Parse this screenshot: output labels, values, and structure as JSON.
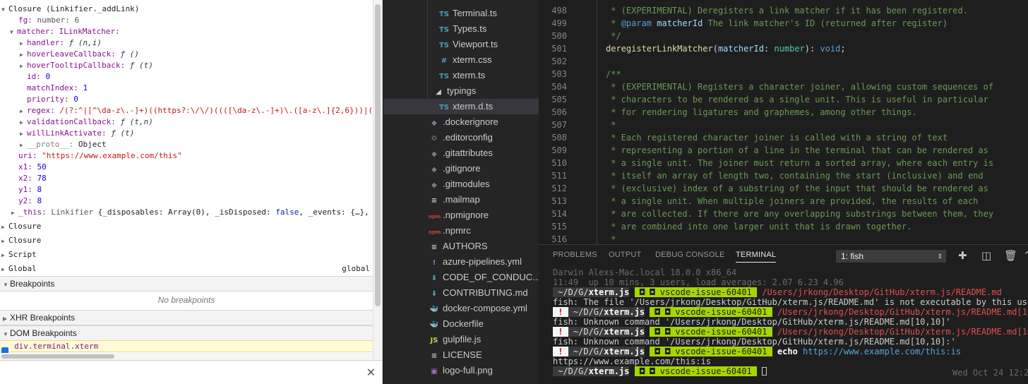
{
  "devtools": {
    "scope": {
      "closure_header": "Closure (Linkifier._addLink)",
      "fg_key": "fg:",
      "fg_value": "number: 6",
      "matcher_key": "matcher:",
      "matcher_type": "ILinkMatcher:",
      "handler_key": "handler:",
      "handler_val": "ƒ (n,i)",
      "hoverLeave_key": "hoverLeaveCallback:",
      "hoverLeave_val": "ƒ ()",
      "hoverTooltip_key": "hoverTooltipCallback:",
      "hoverTooltip_val": "ƒ (t)",
      "id_key": "id:",
      "id_val": "0",
      "matchIndex_key": "matchIndex:",
      "matchIndex_val": "1",
      "priority_key": "priority:",
      "priority_val": "0",
      "regex_key": "regex:",
      "regex_val": "/(?:^|[^\\da-z\\.-]+)((https?:\\/\\/)((([\\da-z\\.-]+)\\.([a-z\\.]{2,6}))|(",
      "validation_key": "validationCallback:",
      "validation_val": "ƒ (t,n)",
      "willLink_key": "willLinkActivate:",
      "willLink_val": "ƒ (t)",
      "proto_key": "__proto__:",
      "proto_val": "Object",
      "uri_key": "uri:",
      "uri_val": "\"https://www.example.com/this\"",
      "x1_key": "x1:",
      "x1_val": "50",
      "x2_key": "x2:",
      "x2_val": "78",
      "y1_key": "y1:",
      "y1_val": "8",
      "y2_key": "y2:",
      "y2_val": "8",
      "this_key": "_this:",
      "this_class": "Linkifier",
      "this_val_a": "{_disposables: Array(0), _isDisposed:",
      "this_val_b": "false",
      "this_val_c": ", _events: {…},",
      "closure2": "Closure",
      "closure3": "Closure",
      "script": "Script",
      "global": "Global",
      "global_right": "global"
    },
    "breakpoints": {
      "title": "Breakpoints",
      "empty": "No breakpoints"
    },
    "xhr": {
      "title": "XHR Breakpoints"
    },
    "dom": {
      "title": "DOM Breakpoints",
      "item": "div.terminal.xterm"
    },
    "close_glyph": "✕"
  },
  "explorer": {
    "files": [
      {
        "icon": "TS",
        "name": "Terminal.ts"
      },
      {
        "icon": "TS",
        "name": "Types.ts"
      },
      {
        "icon": "TS",
        "name": "Viewport.ts"
      },
      {
        "icon": "#",
        "name": "xterm.css"
      },
      {
        "icon": "TS",
        "name": "xterm.ts"
      },
      {
        "icon": "◢",
        "name": "typings"
      },
      {
        "icon": "TS",
        "name": "xterm.d.ts"
      },
      {
        "icon": "◆",
        "name": ".dockerignore"
      },
      {
        "icon": "⚙",
        "name": ".editorconfig"
      },
      {
        "icon": "◆",
        "name": ".gitattributes"
      },
      {
        "icon": "◆",
        "name": ".gitignore"
      },
      {
        "icon": "◆",
        "name": ".gitmodules"
      },
      {
        "icon": "≡",
        "name": ".mailmap"
      },
      {
        "icon": "npm",
        "name": ".npmignore"
      },
      {
        "icon": "npm",
        "name": ".npmrc"
      },
      {
        "icon": "≡",
        "name": "AUTHORS"
      },
      {
        "icon": "!",
        "name": "azure-pipelines.yml"
      },
      {
        "icon": "⬇",
        "name": "CODE_OF_CONDUC..."
      },
      {
        "icon": "⬇",
        "name": "CONTRIBUTING.md"
      },
      {
        "icon": "🐳",
        "name": "docker-compose.yml"
      },
      {
        "icon": "🐳",
        "name": "Dockerfile"
      },
      {
        "icon": "JS",
        "name": "gulpfile.js"
      },
      {
        "icon": "≡",
        "name": "LICENSE"
      },
      {
        "icon": "▣",
        "name": "logo-full.png"
      }
    ]
  },
  "editor": {
    "lines": [
      {
        "n": "498",
        "text": " * (EXPERIMENTAL) Deregisters a link matcher if it has been registered."
      },
      {
        "n": "499",
        "text": " * @param matcherId The link matcher's ID (returned after register)"
      },
      {
        "n": "500",
        "text": " */"
      },
      {
        "n": "501",
        "text": "deregisterLinkMatcher(matcherId: number): void;"
      },
      {
        "n": "502",
        "text": ""
      },
      {
        "n": "503",
        "text": "/**"
      },
      {
        "n": "504",
        "text": " * (EXPERIMENTAL) Registers a character joiner, allowing custom sequences of"
      },
      {
        "n": "505",
        "text": " * characters to be rendered as a single unit. This is useful in particular"
      },
      {
        "n": "506",
        "text": " * for rendering ligatures and graphemes, among other things."
      },
      {
        "n": "507",
        "text": " *"
      },
      {
        "n": "508",
        "text": " * Each registered character joiner is called with a string of text"
      },
      {
        "n": "509",
        "text": " * representing a portion of a line in the terminal that can be rendered as"
      },
      {
        "n": "510",
        "text": " * a single unit. The joiner must return a sorted array, where each entry is"
      },
      {
        "n": "511",
        "text": " * itself an array of length two, containing the start (inclusive) and end"
      },
      {
        "n": "512",
        "text": " * (exclusive) index of a substring of the input that should be rendered as"
      },
      {
        "n": "513",
        "text": " * a single unit. When multiple joiners are provided, the results of each"
      },
      {
        "n": "514",
        "text": " * are collected. If there are any overlapping substrings between them, they"
      },
      {
        "n": "515",
        "text": " * are combined into one larger unit that is drawn together."
      },
      {
        "n": "516",
        "text": " *"
      }
    ],
    "l499_param": "@param",
    "l499_id": "matcherId",
    "l499_rest": " The link matcher's ID (returned after register)",
    "l501_fn": "deregisterLinkMatcher",
    "l501_param": "matcherId",
    "l501_type": "number",
    "l501_ret": "void"
  },
  "panel": {
    "tabs": [
      "PROBLEMS",
      "OUTPUT",
      "DEBUG CONSOLE",
      "TERMINAL"
    ],
    "terminal_select": "1: fish",
    "terminal": {
      "line1": "Darwin Alexs-Mac.local 18.0.0 x86_64",
      "line2": "11:49  up 10 mins, 3 users, load averages: 2.07 6.23 4.96",
      "dir": " ~/D/G/",
      "repo": "xterm.js",
      "branch": " ◘ ◘ vscode-issue-60401 ",
      "bang": " ! ",
      "cmd1_path": "/Users/jrkong/Desktop/GitHub/xterm.js/README.md",
      "err1": "fish: The file '/Users/jrkong/Desktop/GitHub/xterm.js/README.md' is not executable by this user",
      "cmd2_path": "/Users/jrkong/Desktop/GitHub/xterm.js/README.md[10,",
      "err2": "fish: Unknown command '/Users/jrkong/Desktop/GitHub/xterm.js/README.md[10,10]'",
      "cmd3_path": "/Users/jrkong/Desktop/GitHub/xterm.js/README.md[10,",
      "err3": "fish: Unknown command '/Users/jrkong/Desktop/GitHub/xterm.js/README.md[10,10]:'",
      "cmd4_echo": "echo",
      "cmd4_url": "https://www.example.com/this:is",
      "out4": "https://www.example.com/this:is",
      "date": "Wed Oct 24 12:2"
    }
  }
}
